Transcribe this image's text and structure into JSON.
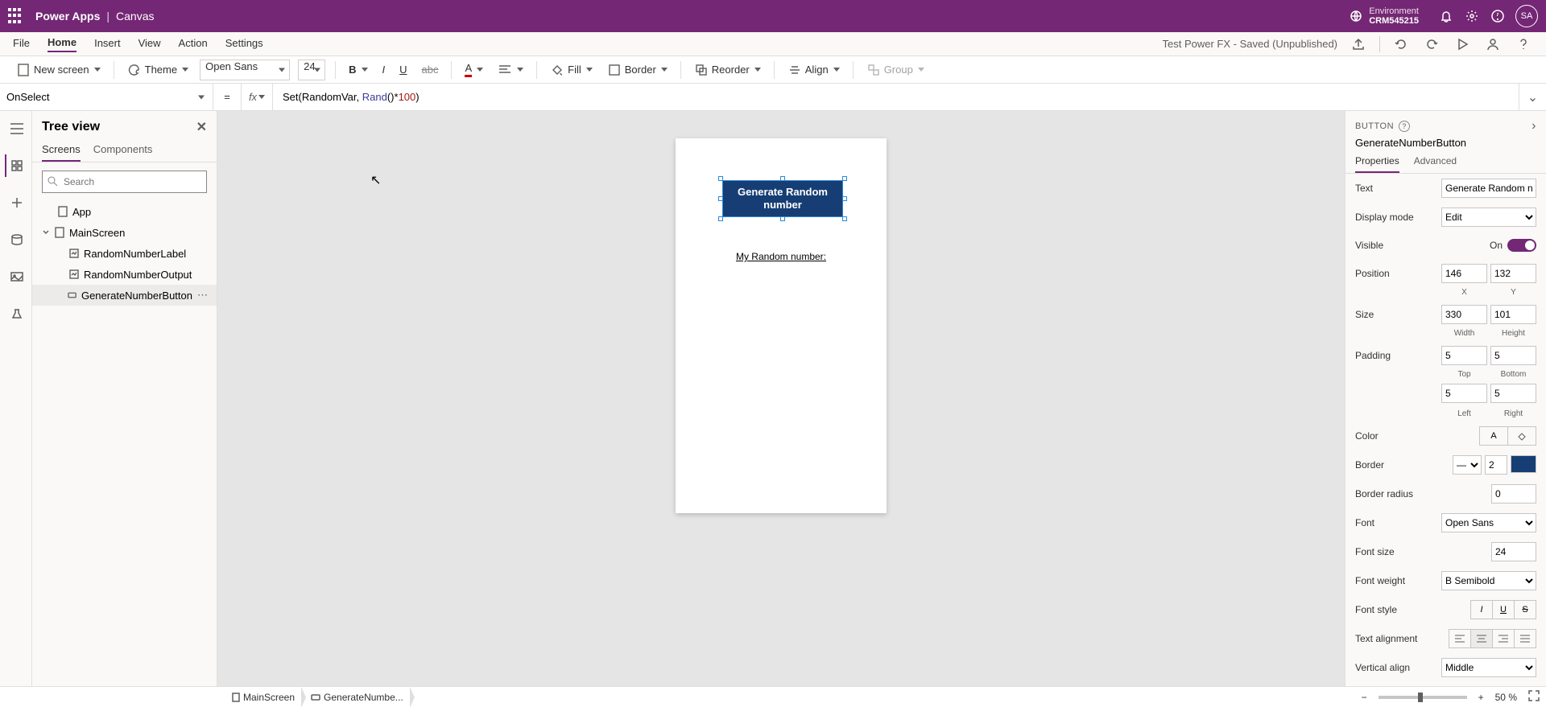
{
  "header": {
    "brand": "Power Apps",
    "context": "Canvas",
    "env_label": "Environment",
    "env_name": "CRM545215",
    "avatar": "SA"
  },
  "menu": {
    "items": [
      "File",
      "Home",
      "Insert",
      "View",
      "Action",
      "Settings"
    ],
    "active": "Home",
    "app_title": "Test Power FX - Saved (Unpublished)"
  },
  "ribbon": {
    "new_screen": "New screen",
    "theme": "Theme",
    "font_family": "Open Sans",
    "font_size": "24",
    "fill": "Fill",
    "border": "Border",
    "reorder": "Reorder",
    "align": "Align",
    "group": "Group"
  },
  "formula": {
    "property": "OnSelect",
    "fx": "fx",
    "text_prefix": "Set(RandomVar, ",
    "fn": "Rand",
    "mid": "()*",
    "num": "100",
    "suffix": ")"
  },
  "tree": {
    "title": "Tree view",
    "tabs": [
      "Screens",
      "Components"
    ],
    "active_tab": "Screens",
    "search_placeholder": "Search",
    "items": [
      {
        "label": "App"
      },
      {
        "label": "MainScreen"
      },
      {
        "label": "RandomNumberLabel"
      },
      {
        "label": "RandomNumberOutput"
      },
      {
        "label": "GenerateNumberButton"
      }
    ],
    "selected": "GenerateNumberButton"
  },
  "canvas": {
    "button_text": "Generate Random number",
    "label_text": "My Random number:"
  },
  "props": {
    "type": "BUTTON",
    "name": "GenerateNumberButton",
    "tabs": [
      "Properties",
      "Advanced"
    ],
    "active_tab": "Properties",
    "rows": {
      "Text": "Generate Random number",
      "DisplayMode": "Edit",
      "Visible": "On",
      "Position": {
        "x": "146",
        "y": "132",
        "lx": "X",
        "ly": "Y"
      },
      "Size": {
        "w": "330",
        "h": "101",
        "lw": "Width",
        "lh": "Height"
      },
      "Padding": {
        "t": "5",
        "b": "5",
        "l": "5",
        "r": "5",
        "lt": "Top",
        "lb": "Bottom",
        "ll": "Left",
        "lr": "Right"
      },
      "Color_label": "Color",
      "Border": {
        "label": "Border",
        "width": "2"
      },
      "BorderRadius": {
        "label": "Border radius",
        "value": "0"
      },
      "Font": {
        "label": "Font",
        "value": "Open Sans"
      },
      "FontSize": {
        "label": "Font size",
        "value": "24"
      },
      "FontWeight": {
        "label": "Font weight",
        "value": "Semibold"
      },
      "FontStyle_label": "Font style",
      "TextAlign_label": "Text alignment",
      "VerticalAlign": {
        "label": "Vertical align",
        "value": "Middle"
      }
    },
    "labels": {
      "Text": "Text",
      "DisplayMode": "Display mode",
      "Visible": "Visible",
      "Position": "Position",
      "Size": "Size",
      "Padding": "Padding"
    }
  },
  "statusbar": {
    "crumb1": "MainScreen",
    "crumb2": "GenerateNumbe...",
    "zoom": "50",
    "zoom_unit": "%"
  }
}
